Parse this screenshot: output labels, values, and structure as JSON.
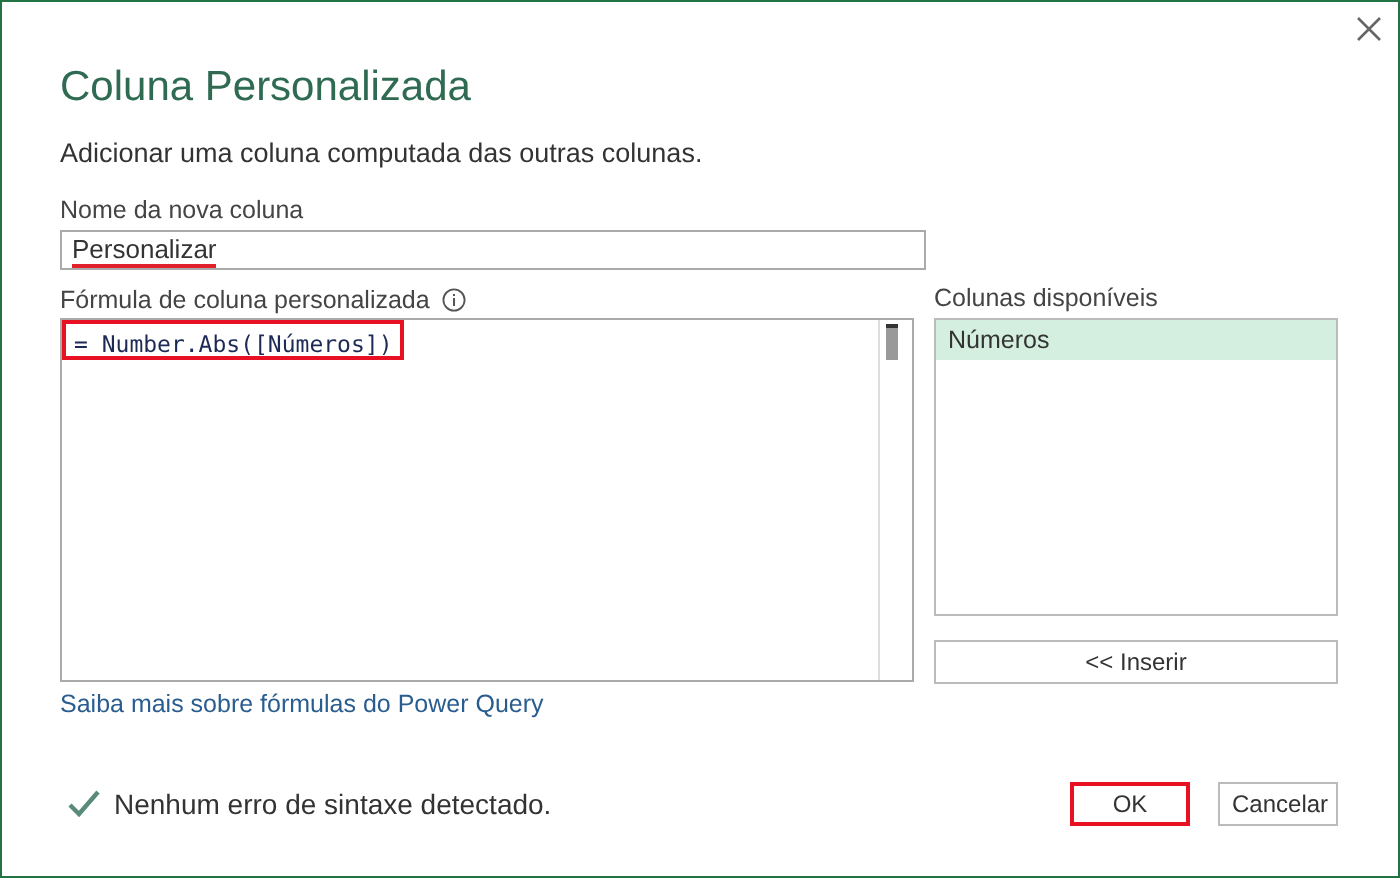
{
  "dialog": {
    "title": "Coluna Personalizada",
    "description": "Adicionar uma coluna computada das outras colunas."
  },
  "name_field": {
    "label": "Nome da nova coluna",
    "value": "Personalizar",
    "spellcheck_error": true
  },
  "formula": {
    "label": "Fórmula de coluna personalizada",
    "value": "= Number.Abs([Números])",
    "highlighted": true
  },
  "available_columns": {
    "label": "Colunas disponíveis",
    "items": [
      {
        "label": "Números",
        "selected": true
      }
    ],
    "insert_button": "<< Inserir"
  },
  "help_link": "Saiba mais sobre fórmulas do Power Query",
  "status": {
    "ok": true,
    "text": "Nenhum erro de sintaxe detectado."
  },
  "buttons": [
    {
      "label": "OK",
      "highlighted": true
    },
    {
      "label": "Cancelar",
      "highlighted": false
    }
  ]
}
